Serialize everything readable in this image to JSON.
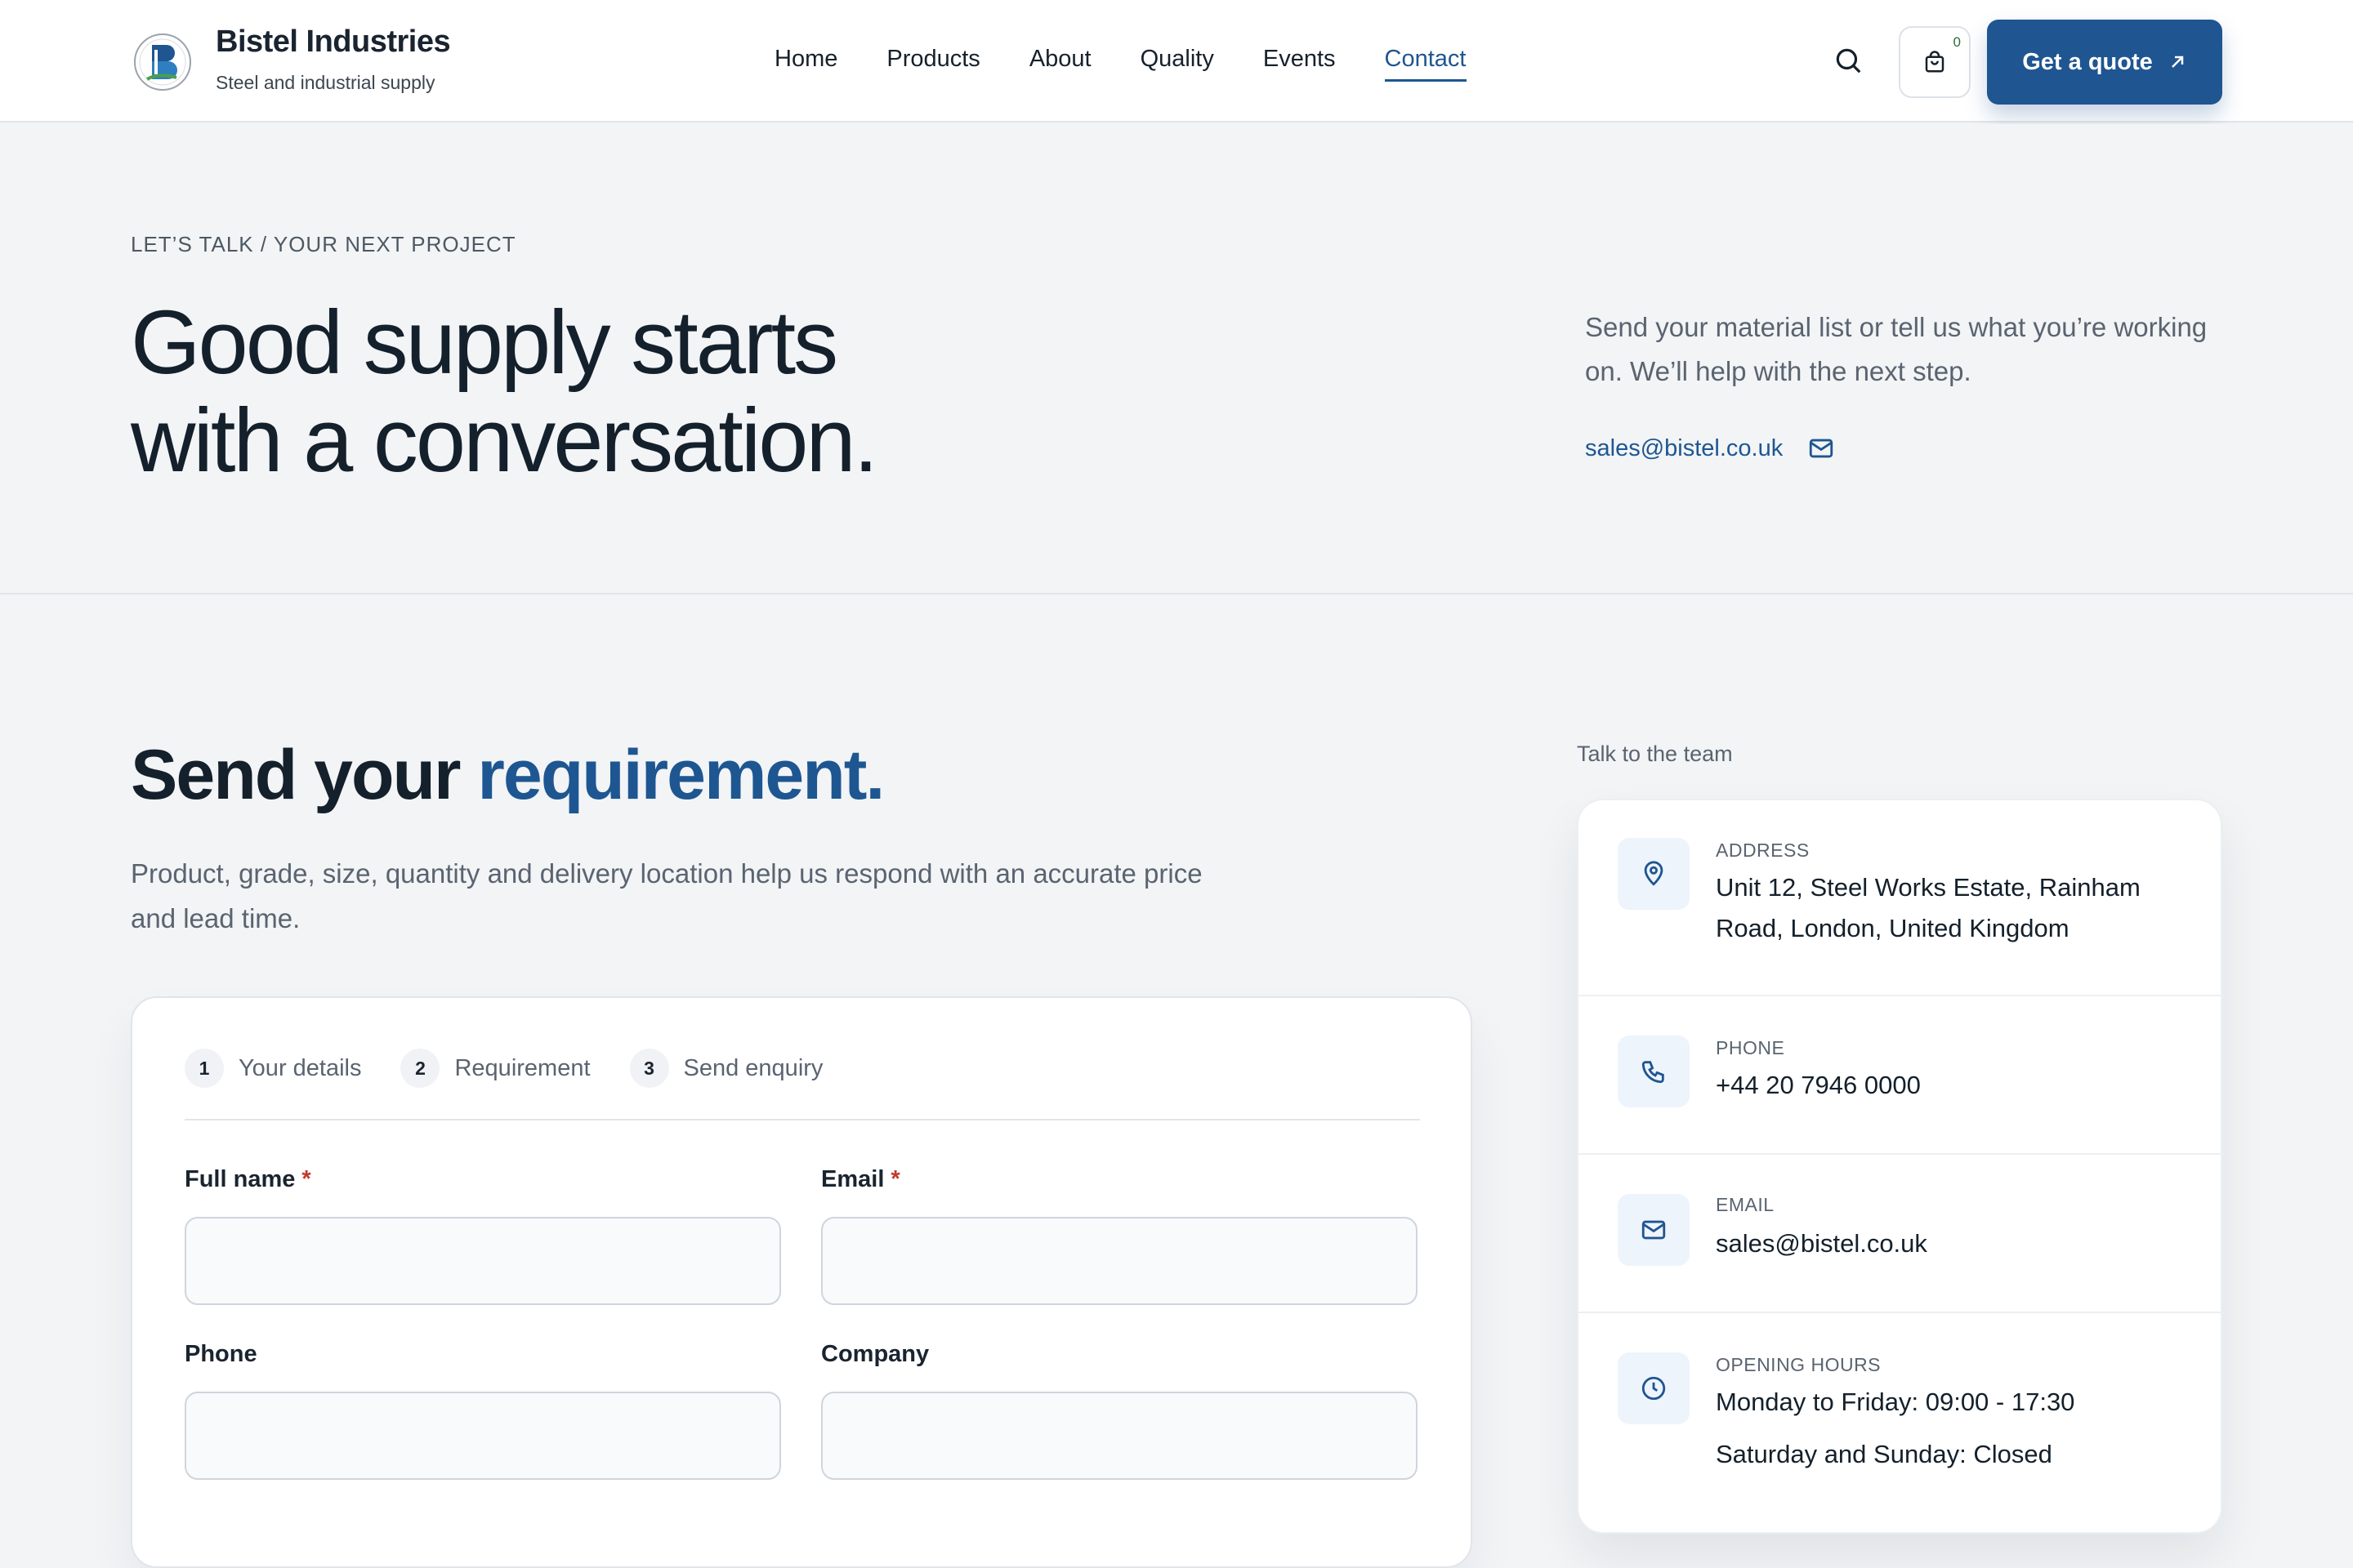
{
  "brand": {
    "name": "Bistel Industries",
    "tagline": "Steel and industrial supply"
  },
  "nav": {
    "items": [
      "Home",
      "Products",
      "About",
      "Quality",
      "Events",
      "Contact"
    ],
    "active": "Contact"
  },
  "header": {
    "cart_count": "0",
    "quote_label": "Get a quote"
  },
  "hero": {
    "eyebrow": "LET’S TALK / YOUR NEXT PROJECT",
    "title_line1": "Good supply starts",
    "title_line2": "with a conversation.",
    "description": "Send your material list or tell us what you’re working on. We’ll help with the next step.",
    "email": "sales@bistel.co.uk"
  },
  "requirement": {
    "title_prefix": "Send your ",
    "title_accent": "requirement.",
    "description": "Product, grade, size, quantity and delivery location help us respond with an accurate price and lead time."
  },
  "form": {
    "steps": [
      {
        "num": "1",
        "label": "Your details"
      },
      {
        "num": "2",
        "label": "Requirement"
      },
      {
        "num": "3",
        "label": "Send enquiry"
      }
    ],
    "fields": {
      "full_name": {
        "label": "Full name",
        "required": "*",
        "value": ""
      },
      "email": {
        "label": "Email",
        "required": "*",
        "value": ""
      },
      "phone": {
        "label": "Phone",
        "value": ""
      },
      "company": {
        "label": "Company",
        "value": ""
      }
    }
  },
  "contact": {
    "panel_label": "Talk to the team",
    "address_key": "ADDRESS",
    "address_value": "Unit 12, Steel Works Estate, Rainham Road, London, United Kingdom",
    "phone_key": "PHONE",
    "phone_value": "+44 20 7946 0000",
    "email_key": "EMAIL",
    "email_value": "sales@bistel.co.uk",
    "hours_key": "OPENING HOURS",
    "hours_weekday": "Monday to Friday: 09:00 - 17:30",
    "hours_weekend": "Saturday and Sunday: Closed"
  },
  "colors": {
    "primary": "#1f5591",
    "accent_text": "#1e5691",
    "required": "#c0392b",
    "background": "#f2f4f6"
  }
}
